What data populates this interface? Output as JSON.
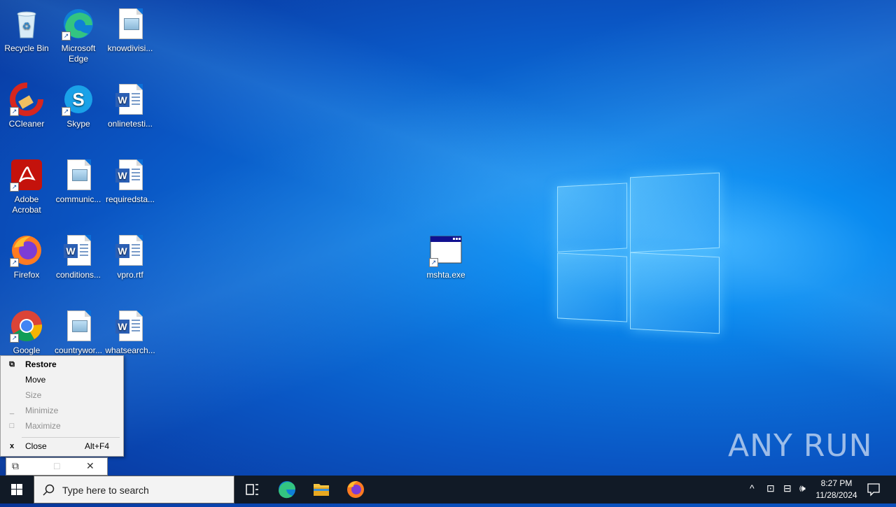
{
  "desktop": {
    "icons": [
      {
        "label": "Recycle Bin"
      },
      {
        "label": "Microsoft Edge"
      },
      {
        "label": "knowdivisi..."
      },
      {
        "label": "CCleaner"
      },
      {
        "label": "Skype"
      },
      {
        "label": "onlinetesti..."
      },
      {
        "label": "Adobe Acrobat"
      },
      {
        "label": "communic..."
      },
      {
        "label": "requiredsta..."
      },
      {
        "label": "Firefox"
      },
      {
        "label": "conditions..."
      },
      {
        "label": "vpro.rtf"
      },
      {
        "label": "Google"
      },
      {
        "label": "countrywor..."
      },
      {
        "label": "whatsearch..."
      },
      {
        "label": "mshta.exe"
      }
    ]
  },
  "context_menu": {
    "items": [
      {
        "label": "Restore",
        "enabled": true,
        "default": true
      },
      {
        "label": "Move",
        "enabled": true
      },
      {
        "label": "Size",
        "enabled": false
      },
      {
        "label": "Minimize",
        "enabled": false
      },
      {
        "label": "Maximize",
        "enabled": false
      },
      {
        "label": "Close",
        "accelerator": "Alt+F4",
        "enabled": true
      }
    ]
  },
  "watermark": "ANY RUN",
  "taskbar": {
    "search_placeholder": "Type here to search",
    "clock": {
      "time": "8:27 PM",
      "date": "11/28/2024"
    }
  },
  "colors": {
    "taskbar": "#111a26",
    "accent": "#0a6fd8"
  }
}
